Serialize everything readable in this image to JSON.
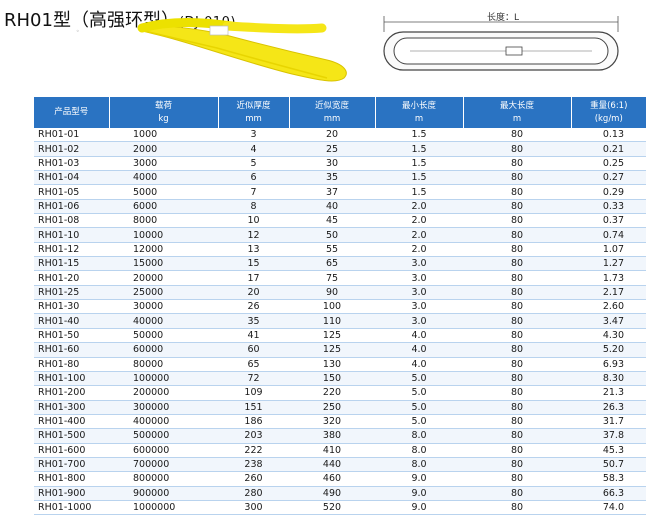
{
  "title": {
    "main": "RH01型（高强环型）",
    "code": "(DJ-010)"
  },
  "diagram": {
    "length_label": "长度：L"
  },
  "table": {
    "headers": [
      {
        "l1": "产品型号",
        "l2": ""
      },
      {
        "l1": "载荷",
        "l2": "kg"
      },
      {
        "l1": "近似厚度",
        "l2": "mm"
      },
      {
        "l1": "近似宽度",
        "l2": "mm"
      },
      {
        "l1": "最小长度",
        "l2": "m"
      },
      {
        "l1": "最大长度",
        "l2": "m"
      },
      {
        "l1": "重量(6:1)",
        "l2": "(kg/m)"
      }
    ],
    "rows": [
      [
        "RH01-01",
        "1000",
        "3",
        "20",
        "1.5",
        "80",
        "0.13"
      ],
      [
        "RH01-02",
        "2000",
        "4",
        "25",
        "1.5",
        "80",
        "0.21"
      ],
      [
        "RH01-03",
        "3000",
        "5",
        "30",
        "1.5",
        "80",
        "0.25"
      ],
      [
        "RH01-04",
        "4000",
        "6",
        "35",
        "1.5",
        "80",
        "0.27"
      ],
      [
        "RH01-05",
        "5000",
        "7",
        "37",
        "1.5",
        "80",
        "0.29"
      ],
      [
        "RH01-06",
        "6000",
        "8",
        "40",
        "2.0",
        "80",
        "0.33"
      ],
      [
        "RH01-08",
        "8000",
        "10",
        "45",
        "2.0",
        "80",
        "0.37"
      ],
      [
        "RH01-10",
        "10000",
        "12",
        "50",
        "2.0",
        "80",
        "0.74"
      ],
      [
        "RH01-12",
        "12000",
        "13",
        "55",
        "2.0",
        "80",
        "1.07"
      ],
      [
        "RH01-15",
        "15000",
        "15",
        "65",
        "3.0",
        "80",
        "1.27"
      ],
      [
        "RH01-20",
        "20000",
        "17",
        "75",
        "3.0",
        "80",
        "1.73"
      ],
      [
        "RH01-25",
        "25000",
        "20",
        "90",
        "3.0",
        "80",
        "2.17"
      ],
      [
        "RH01-30",
        "30000",
        "26",
        "100",
        "3.0",
        "80",
        "2.60"
      ],
      [
        "RH01-40",
        "40000",
        "35",
        "110",
        "3.0",
        "80",
        "3.47"
      ],
      [
        "RH01-50",
        "50000",
        "41",
        "125",
        "4.0",
        "80",
        "4.30"
      ],
      [
        "RH01-60",
        "60000",
        "60",
        "125",
        "4.0",
        "80",
        "5.20"
      ],
      [
        "RH01-80",
        "80000",
        "65",
        "130",
        "4.0",
        "80",
        "6.93"
      ],
      [
        "RH01-100",
        "100000",
        "72",
        "150",
        "5.0",
        "80",
        "8.30"
      ],
      [
        "RH01-200",
        "200000",
        "109",
        "220",
        "5.0",
        "80",
        "21.3"
      ],
      [
        "RH01-300",
        "300000",
        "151",
        "250",
        "5.0",
        "80",
        "26.3"
      ],
      [
        "RH01-400",
        "400000",
        "186",
        "320",
        "5.0",
        "80",
        "31.7"
      ],
      [
        "RH01-500",
        "500000",
        "203",
        "380",
        "8.0",
        "80",
        "37.8"
      ],
      [
        "RH01-600",
        "600000",
        "222",
        "410",
        "8.0",
        "80",
        "45.3"
      ],
      [
        "RH01-700",
        "700000",
        "238",
        "440",
        "8.0",
        "80",
        "50.7"
      ],
      [
        "RH01-800",
        "800000",
        "260",
        "460",
        "9.0",
        "80",
        "58.3"
      ],
      [
        "RH01-900",
        "900000",
        "280",
        "490",
        "9.0",
        "80",
        "66.3"
      ],
      [
        "RH01-1000",
        "1000000",
        "300",
        "520",
        "9.0",
        "80",
        "74.0"
      ]
    ]
  },
  "colors": {
    "header_blue": "#2a73c2",
    "sling_yellow": "#f5e617"
  }
}
